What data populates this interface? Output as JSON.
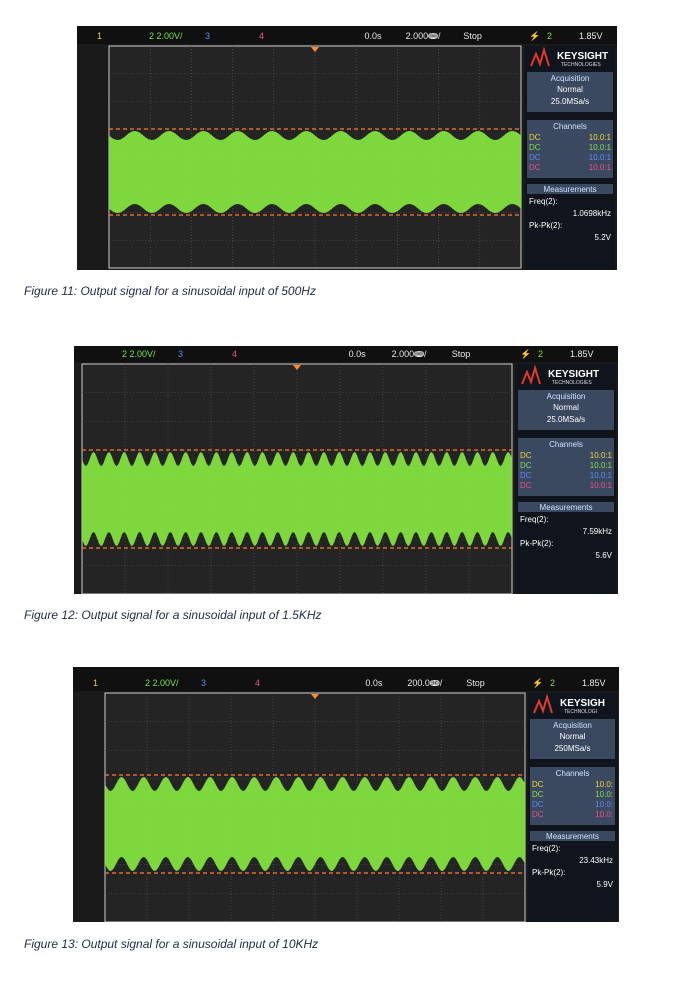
{
  "figures": [
    {
      "caption": "Figure 11: Output signal for a sinusoidal input of 500Hz",
      "scope": {
        "ch1": "1",
        "ch2_label": "2  2.00V/",
        "ch3": "3",
        "ch4": "4",
        "delay": "0.0s",
        "timebase": "2.000ↈ/",
        "run_state": "Stop",
        "trigger_icon": "trigger-icon",
        "trig_channel": "2",
        "trig_level": "1.85V",
        "brand": "KEYSIGHT",
        "brand_sub": "TECHNOLOGIES",
        "acq_title": "Acquisition",
        "acq_mode": "Normal",
        "acq_rate": "25.0MSa/s",
        "channels_title": "Channels",
        "channels": [
          {
            "coupling": "DC",
            "probe": "10.0:1",
            "color": "#f2d43a"
          },
          {
            "coupling": "DC",
            "probe": "10.0:1",
            "color": "#7fe04a"
          },
          {
            "coupling": "DC",
            "probe": "10.0:1",
            "color": "#5a8cf0"
          },
          {
            "coupling": "DC",
            "probe": "10.0:1",
            "color": "#f0508c"
          }
        ],
        "meas_title": "Measurements",
        "freq_label": "Freq(2):",
        "freq_value": "1.0698kHz",
        "pkpk_label": "Pk-Pk(2):",
        "pkpk_value": "5.2V",
        "ripple_cycles": 12
      }
    },
    {
      "caption": "Figure 12: Output signal for a sinusoidal input of 1.5KHz",
      "scope": {
        "ch1": "",
        "ch2_label": "2  2.00V/",
        "ch3": "3",
        "ch4": "4",
        "delay": "0.0s",
        "timebase": "2.000ↈ/",
        "run_state": "Stop",
        "trigger_icon": "trigger-icon",
        "trig_channel": "2",
        "trig_level": "1.85V",
        "brand": "KEYSIGHT",
        "brand_sub": "TECHNOLOGIES",
        "acq_title": "Acquisition",
        "acq_mode": "Normal",
        "acq_rate": "25.0MSa/s",
        "channels_title": "Channels",
        "channels": [
          {
            "coupling": "DC",
            "probe": "10.0:1",
            "color": "#f2d43a"
          },
          {
            "coupling": "DC",
            "probe": "10.0:1",
            "color": "#7fe04a"
          },
          {
            "coupling": "DC",
            "probe": "10.0:1",
            "color": "#5a8cf0"
          },
          {
            "coupling": "DC",
            "probe": "10.0:1",
            "color": "#f0508c"
          }
        ],
        "meas_title": "Measurements",
        "freq_label": "Freq(2):",
        "freq_value": "7.59kHz",
        "pkpk_label": "Pk-Pk(2):",
        "pkpk_value": "5.6V",
        "ripple_cycles": 28
      }
    },
    {
      "caption": "Figure 13: Output signal for a sinusoidal input of 10KHz",
      "scope": {
        "ch1": "1",
        "ch2_label": "2  2.00V/",
        "ch3": "3",
        "ch4": "4",
        "delay": "0.0s",
        "timebase": "200.0ↈ/",
        "run_state": "Stop",
        "trigger_icon": "trigger-icon",
        "trig_channel": "2",
        "trig_level": "1.85V",
        "brand": "KEYSIGH",
        "brand_sub": "TECHNOLOGI",
        "acq_title": "Acquisition",
        "acq_mode": "Normal",
        "acq_rate": "250MSa/s",
        "channels_title": "Channels",
        "channels": [
          {
            "coupling": "DC",
            "probe": "10.0:",
            "color": "#f2d43a"
          },
          {
            "coupling": "DC",
            "probe": "10.0:",
            "color": "#7fe04a"
          },
          {
            "coupling": "DC",
            "probe": "10.0:",
            "color": "#5a8cf0"
          },
          {
            "coupling": "DC",
            "probe": "10.0:",
            "color": "#f0508c"
          }
        ],
        "meas_title": "Measurements",
        "freq_label": "Freq(2):",
        "freq_value": "23.43kHz",
        "pkpk_label": "Pk-Pk(2):",
        "pkpk_value": "5.9V",
        "ripple_cycles": 19
      }
    }
  ]
}
